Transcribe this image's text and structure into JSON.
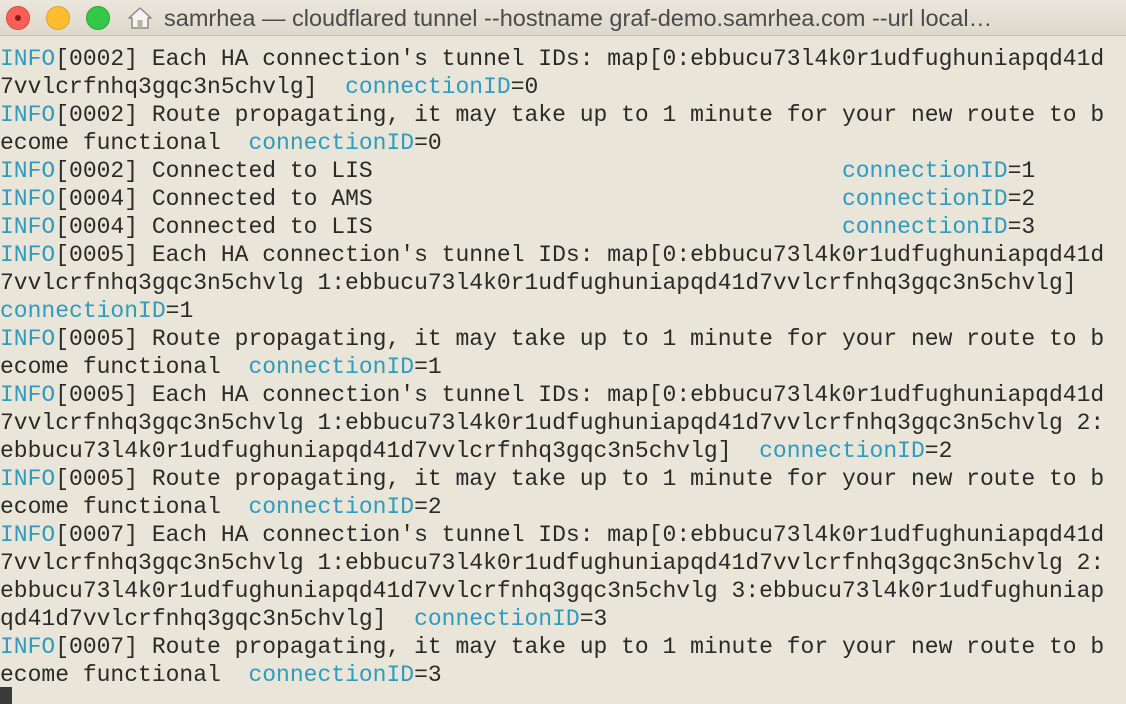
{
  "window": {
    "title": "samrhea — cloudflared tunnel --hostname graf-demo.samrhea.com --url local…"
  },
  "icons": {
    "close": "close-button",
    "minimize": "minimize-button",
    "zoom": "zoom-button",
    "home": "home-folder-icon"
  },
  "colors": {
    "background": "#e9e5d8",
    "text": "#2b2a26",
    "highlight": "#2e9bbf"
  },
  "terminal": {
    "lines": [
      [
        {
          "t": "INFO",
          "c": "lvl"
        },
        {
          "t": "[0002] Each HA connection's tunnel IDs: map[0:ebbucu73l4k0r1udfughuniapqd41d"
        }
      ],
      [
        {
          "t": "7vvlcrfnhq3gqc3n5chvlg]  "
        },
        {
          "t": "connectionID",
          "c": "key"
        },
        {
          "t": "=0"
        }
      ],
      [
        {
          "t": "INFO",
          "c": "lvl"
        },
        {
          "t": "[0002] Route propagating, it may take up to 1 minute for your new route to b"
        }
      ],
      [
        {
          "t": "ecome functional  "
        },
        {
          "t": "connectionID",
          "c": "key"
        },
        {
          "t": "=0"
        }
      ],
      [
        {
          "t": "INFO",
          "c": "lvl"
        },
        {
          "t": "[0002] Connected to LIS                                  "
        },
        {
          "t": "connectionID",
          "c": "key"
        },
        {
          "t": "=1"
        }
      ],
      [
        {
          "t": "INFO",
          "c": "lvl"
        },
        {
          "t": "[0004] Connected to AMS                                  "
        },
        {
          "t": "connectionID",
          "c": "key"
        },
        {
          "t": "=2"
        }
      ],
      [
        {
          "t": "INFO",
          "c": "lvl"
        },
        {
          "t": "[0004] Connected to LIS                                  "
        },
        {
          "t": "connectionID",
          "c": "key"
        },
        {
          "t": "=3"
        }
      ],
      [
        {
          "t": "INFO",
          "c": "lvl"
        },
        {
          "t": "[0005] Each HA connection's tunnel IDs: map[0:ebbucu73l4k0r1udfughuniapqd41d"
        }
      ],
      [
        {
          "t": "7vvlcrfnhq3gqc3n5chvlg 1:ebbucu73l4k0r1udfughuniapqd41d7vvlcrfnhq3gqc3n5chvlg]"
        }
      ],
      [
        {
          "t": "connectionID",
          "c": "key"
        },
        {
          "t": "=1"
        }
      ],
      [
        {
          "t": "INFO",
          "c": "lvl"
        },
        {
          "t": "[0005] Route propagating, it may take up to 1 minute for your new route to b"
        }
      ],
      [
        {
          "t": "ecome functional  "
        },
        {
          "t": "connectionID",
          "c": "key"
        },
        {
          "t": "=1"
        }
      ],
      [
        {
          "t": "INFO",
          "c": "lvl"
        },
        {
          "t": "[0005] Each HA connection's tunnel IDs: map[0:ebbucu73l4k0r1udfughuniapqd41d"
        }
      ],
      [
        {
          "t": "7vvlcrfnhq3gqc3n5chvlg 1:ebbucu73l4k0r1udfughuniapqd41d7vvlcrfnhq3gqc3n5chvlg 2:"
        }
      ],
      [
        {
          "t": "ebbucu73l4k0r1udfughuniapqd41d7vvlcrfnhq3gqc3n5chvlg]  "
        },
        {
          "t": "connectionID",
          "c": "key"
        },
        {
          "t": "=2"
        }
      ],
      [
        {
          "t": "INFO",
          "c": "lvl"
        },
        {
          "t": "[0005] Route propagating, it may take up to 1 minute for your new route to b"
        }
      ],
      [
        {
          "t": "ecome functional  "
        },
        {
          "t": "connectionID",
          "c": "key"
        },
        {
          "t": "=2"
        }
      ],
      [
        {
          "t": "INFO",
          "c": "lvl"
        },
        {
          "t": "[0007] Each HA connection's tunnel IDs: map[0:ebbucu73l4k0r1udfughuniapqd41d"
        }
      ],
      [
        {
          "t": "7vvlcrfnhq3gqc3n5chvlg 1:ebbucu73l4k0r1udfughuniapqd41d7vvlcrfnhq3gqc3n5chvlg 2:"
        }
      ],
      [
        {
          "t": "ebbucu73l4k0r1udfughuniapqd41d7vvlcrfnhq3gqc3n5chvlg 3:ebbucu73l4k0r1udfughuniap"
        }
      ],
      [
        {
          "t": "qd41d7vvlcrfnhq3gqc3n5chvlg]  "
        },
        {
          "t": "connectionID",
          "c": "key"
        },
        {
          "t": "=3"
        }
      ],
      [
        {
          "t": "INFO",
          "c": "lvl"
        },
        {
          "t": "[0007] Route propagating, it may take up to 1 minute for your new route to b"
        }
      ],
      [
        {
          "t": "ecome functional  "
        },
        {
          "t": "connectionID",
          "c": "key"
        },
        {
          "t": "=3"
        }
      ]
    ]
  }
}
